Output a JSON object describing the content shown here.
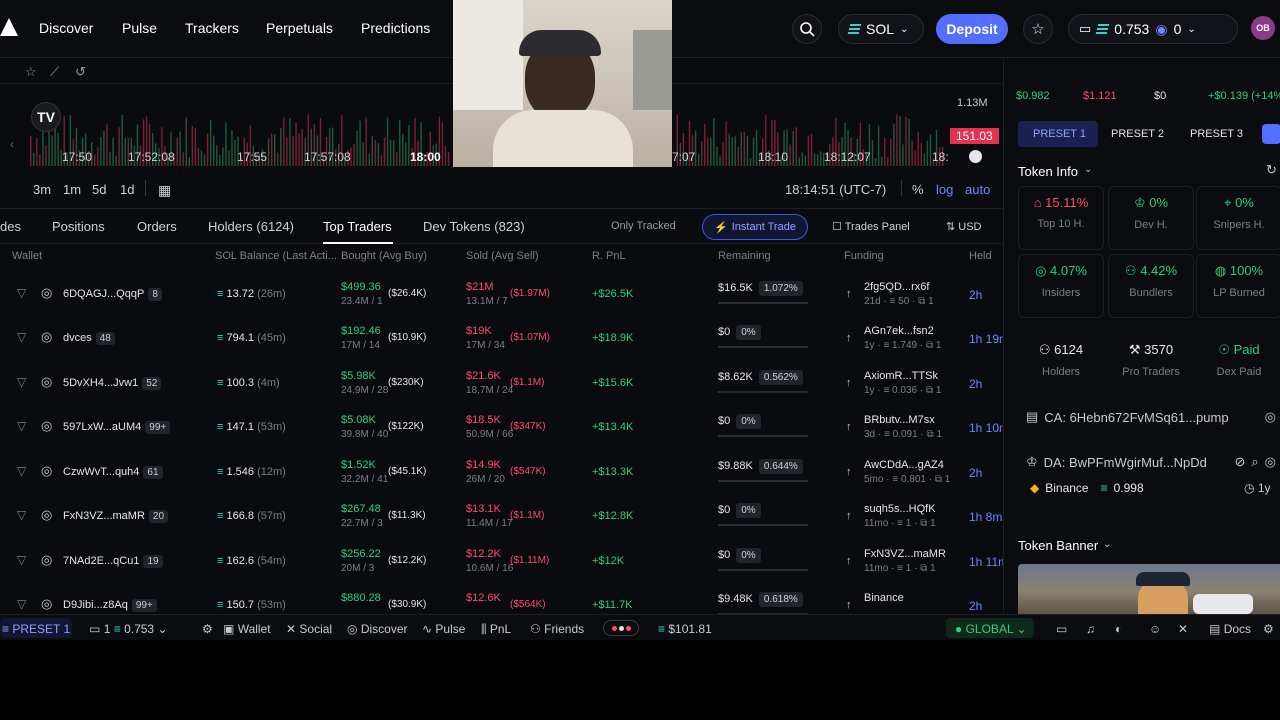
{
  "nav": {
    "links": [
      "Discover",
      "Pulse",
      "Trackers",
      "Perpetuals",
      "Predictions"
    ],
    "chain": "SOL",
    "deposit": "Deposit",
    "wallet_balance": "0.753",
    "wallet_other": "0",
    "avatar": "OB"
  },
  "chart": {
    "ylabels": {
      "vol": "1.13M",
      "price": "151.03"
    },
    "xlabels": [
      "17:50",
      "17:52:08",
      "17:55",
      "17:57:08",
      "18:00",
      "7:07",
      "18:10",
      "18:12:07",
      "18:"
    ],
    "timeframes": [
      "3m",
      "1m",
      "5d",
      "1d"
    ],
    "clock": "18:14:51 (UTC-7)",
    "pct": "%",
    "log": "log",
    "auto": "auto"
  },
  "tabs": {
    "items": [
      "des",
      "Positions",
      "Orders",
      "Holders (6124)",
      "Top Traders",
      "Dev Tokens (823)"
    ],
    "only_tracked": "Only Tracked",
    "instant_trade": "Instant Trade",
    "trades_panel": "Trades Panel",
    "currency": "USD"
  },
  "table": {
    "headers": [
      "Wallet",
      "SOL Balance (Last Acti...",
      "Bought (Avg Buy)",
      "Sold (Avg Sell)",
      "R. PnL",
      "Remaining",
      "Funding",
      "Held"
    ],
    "rows": [
      {
        "wallet": "6DQAGJ...QqqP",
        "count": "8",
        "sol": "13.72",
        "sol_time": "(26m)",
        "bought": "$499.36",
        "bought_avg": "($26.4K)",
        "bought_sub": "23.4M / 1",
        "sold": "$21M",
        "sold_avg": "($1.97M)",
        "sold_sub": "13.1M / 7",
        "pnl": "+$26.5K",
        "remaining": "$16.5K",
        "rem_pct": "1.072%",
        "fund_name": "2fg5QD...rx6f",
        "fund_sub": "21d · ≡ 50 · ⧉ 1",
        "held": "2h"
      },
      {
        "wallet": "dvces",
        "count": "48",
        "sol": "794.1",
        "sol_time": "(45m)",
        "bought": "$192.46",
        "bought_avg": "($10.9K)",
        "bought_sub": "17M / 14",
        "sold": "$19K",
        "sold_avg": "($1.07M)",
        "sold_sub": "17M / 34",
        "pnl": "+$18.9K",
        "remaining": "$0",
        "rem_pct": "0%",
        "fund_name": "AGn7ek...fsn2",
        "fund_sub": "1y · ≡ 1.749 · ⧉ 1",
        "held": "1h 19m"
      },
      {
        "wallet": "5DvXH4...Jvw1",
        "count": "52",
        "sol": "100.3",
        "sol_time": "(4m)",
        "bought": "$5.98K",
        "bought_avg": "($230K)",
        "bought_sub": "24.9M / 28",
        "sold": "$21.6K",
        "sold_avg": "($1.1M)",
        "sold_sub": "18.7M / 24",
        "pnl": "+$15.6K",
        "remaining": "$8.62K",
        "rem_pct": "0.562%",
        "fund_name": "AxiomR...TTSk",
        "fund_sub": "1y · ≡ 0.036 · ⧉ 1",
        "held": "2h"
      },
      {
        "wallet": "597LxW...aUM4",
        "count": "99+",
        "sol": "147.1",
        "sol_time": "(53m)",
        "bought": "$5.08K",
        "bought_avg": "($122K)",
        "bought_sub": "39.8M / 40",
        "sold": "$18.5K",
        "sold_avg": "($347K)",
        "sold_sub": "50.9M / 66",
        "pnl": "+$13.4K",
        "remaining": "$0",
        "rem_pct": "0%",
        "fund_name": "BRbutv...M7sx",
        "fund_sub": "3d · ≡ 0.091 · ⧉ 1",
        "held": "1h 10m"
      },
      {
        "wallet": "CzwWvT...quh4",
        "count": "61",
        "sol": "1.546",
        "sol_time": "(12m)",
        "bought": "$1.52K",
        "bought_avg": "($45.1K)",
        "bought_sub": "32.2M / 41",
        "sold": "$14.9K",
        "sold_avg": "($547K)",
        "sold_sub": "26M / 20",
        "pnl": "+$13.3K",
        "remaining": "$9.88K",
        "rem_pct": "0.644%",
        "fund_name": "AwCDdA...gAZ4",
        "fund_sub": "5mo · ≡ 0.801 · ⧉ 1",
        "held": "2h"
      },
      {
        "wallet": "FxN3VZ...maMR",
        "count": "20",
        "sol": "166.8",
        "sol_time": "(57m)",
        "bought": "$267.48",
        "bought_avg": "($11.3K)",
        "bought_sub": "22.7M / 3",
        "sold": "$13.1K",
        "sold_avg": "($1.1M)",
        "sold_sub": "11.4M / 17",
        "pnl": "+$12.8K",
        "remaining": "$0",
        "rem_pct": "0%",
        "fund_name": "suqh5s...HQfK",
        "fund_sub": "11mo · ≡ 1 · ⧉ 1",
        "held": "1h 8m"
      },
      {
        "wallet": "7NAd2E...qCu1",
        "count": "19",
        "sol": "162.6",
        "sol_time": "(54m)",
        "bought": "$256.22",
        "bought_avg": "($12.2K)",
        "bought_sub": "20M / 3",
        "sold": "$12.2K",
        "sold_avg": "($1.11M)",
        "sold_sub": "10.6M / 16",
        "pnl": "+$12K",
        "remaining": "$0",
        "rem_pct": "0%",
        "fund_name": "FxN3VZ...maMR",
        "fund_sub": "11mo · ≡ 1 · ⧉ 1",
        "held": "1h 11m"
      },
      {
        "wallet": "D9Jibi...z8Aq",
        "count": "99+",
        "sol": "150.7",
        "sol_time": "(53m)",
        "bought": "$880.28",
        "bought_avg": "($30.9K)",
        "bought_sub": "",
        "sold": "$12.6K",
        "sold_avg": "($564K)",
        "sold_sub": "",
        "pnl": "+$11.7K",
        "remaining": "$9.48K",
        "rem_pct": "0.618%",
        "fund_name": "Binance",
        "fund_sub": "",
        "held": "2h"
      }
    ]
  },
  "right": {
    "prices": [
      "$0.982",
      "$1.121",
      "$0",
      "+$0.139 (+14%"
    ],
    "presets": [
      "PRESET 1",
      "PRESET 2",
      "PRESET 3"
    ],
    "token_info": "Token Info",
    "stats": [
      {
        "value": "15.11%",
        "label": "Top 10 H."
      },
      {
        "value": "0%",
        "label": "Dev H."
      },
      {
        "value": "0%",
        "label": "Snipers H."
      },
      {
        "value": "4.07%",
        "label": "Insiders"
      },
      {
        "value": "4.42%",
        "label": "Bundlers"
      },
      {
        "value": "100%",
        "label": "LP Burned"
      },
      {
        "value": "6124",
        "label": "Holders"
      },
      {
        "value": "3570",
        "label": "Pro Traders"
      },
      {
        "value": "Paid",
        "label": "Dex Paid"
      }
    ],
    "ca": "CA: 6Hebn672FvMSq61...pump",
    "da": "DA: BwPFmWgirMuf...NpDd",
    "exchange": "Binance",
    "exchange_val": "0.998",
    "age": "1y",
    "token_banner": "Token Banner"
  },
  "bottom": {
    "preset": "PRESET 1",
    "wallet_count": "1",
    "wallet_bal": "0.753",
    "items": [
      "Wallet",
      "Social",
      "Discover",
      "Pulse",
      "PnL",
      "Friends"
    ],
    "balance": "$101.81",
    "region": "GLOBAL",
    "docs": "Docs"
  }
}
